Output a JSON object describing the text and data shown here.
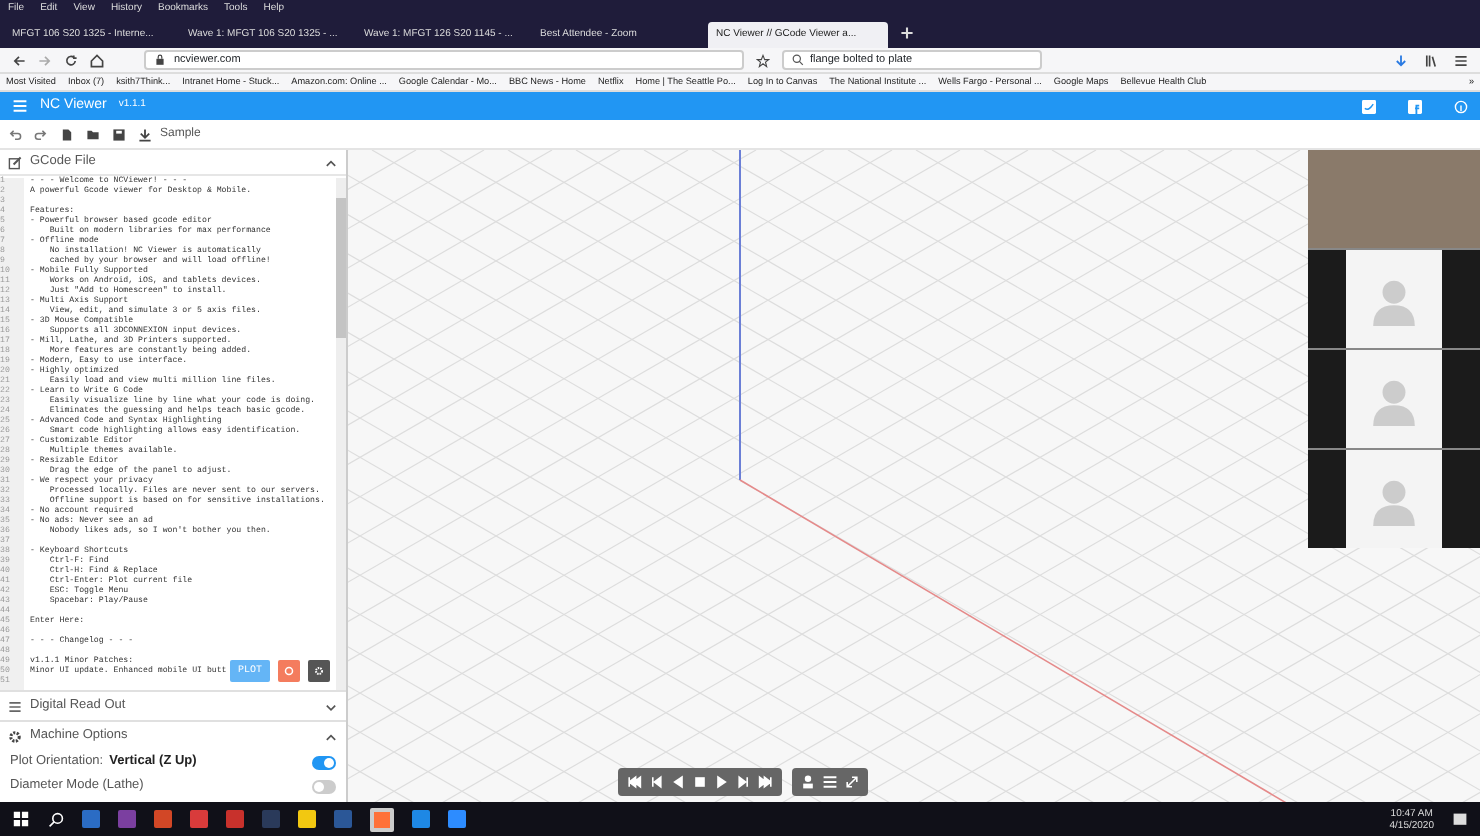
{
  "menu_bar": [
    "File",
    "Edit",
    "View",
    "History",
    "Bookmarks",
    "Tools",
    "Help"
  ],
  "tabs": [
    {
      "label": "MFGT 106 S20 1325 - Interne...",
      "selected": false
    },
    {
      "label": "Wave 1: MFGT 106 S20 1325 - ...",
      "selected": false
    },
    {
      "label": "Wave 1: MFGT 126 S20 1145 - ...",
      "selected": false
    },
    {
      "label": "Best Attendee - Zoom",
      "selected": false
    },
    {
      "label": "NC Viewer // GCode Viewer a...",
      "selected": true
    }
  ],
  "address_bar": {
    "url": "ncviewer.com",
    "search": "flange bolted to plate"
  },
  "bookmarks": [
    "Most Visited",
    "Inbox (7)",
    "ksith7Think...",
    "Intranet Home - Stuck...",
    "Amazon.com: Online ...",
    "Google Calendar - Mo...",
    "BBC News - Home",
    "Netflix",
    "Home | The Seattle Po...",
    "Log In to Canvas",
    "The National Institute ...",
    "Wells Fargo - Personal ...",
    "Google Maps",
    "Bellevue Health Club"
  ],
  "bookmarks_more": "»",
  "app_bar": {
    "title": "NC Viewer",
    "version": "v1.1.1"
  },
  "toolbar": {
    "sample": "Sample"
  },
  "gcode_panel": {
    "title": "GCode File",
    "lines": [
      {
        "n": "1",
        "text": "- - - Welcome to NCViewer! - - -"
      },
      {
        "n": "2",
        "text": "A powerful Gcode viewer for Desktop & Mobile."
      },
      {
        "n": "3"
      },
      {
        "n": "4",
        "text": "Features:"
      },
      {
        "n": "5",
        "text": "- Powerful browser based gcode editor"
      },
      {
        "n": "6",
        "text": "    Built on modern libraries for max performance"
      },
      {
        "n": "7",
        "text": "- Offline mode"
      },
      {
        "n": "8",
        "text": "    No installation! NC Viewer is automatically"
      },
      {
        "n": "9",
        "text": "    cached by your browser and will load offline!"
      },
      {
        "n": "10",
        "text": "- Mobile Fully Supported"
      },
      {
        "n": "11",
        "text": "    Works on Android, iOS, and tablets devices."
      },
      {
        "n": "12",
        "text": "    Just \"Add to Homescreen\" to install."
      },
      {
        "n": "13",
        "text": "- Multi Axis Support"
      },
      {
        "n": "14",
        "text": "    View, edit, and simulate 3 or 5 axis files."
      },
      {
        "n": "15",
        "text": "- 3D Mouse Compatible"
      },
      {
        "n": "16",
        "text": "    Supports all 3DCONNEXION input devices."
      },
      {
        "n": "17",
        "text": "- Mill, Lathe, and 3D Printers supported."
      },
      {
        "n": "18",
        "text": "    More features are constantly being added."
      },
      {
        "n": "19",
        "text": "- Modern, Easy to use interface."
      },
      {
        "n": "20",
        "text": "- Highly optimized"
      },
      {
        "n": "21",
        "text": "    Easily load and view multi million line files."
      },
      {
        "n": "22",
        "text": "- Learn to Write G Code"
      },
      {
        "n": "23",
        "text": "    Easily visualize line by line what your code is doing."
      },
      {
        "n": "24",
        "text": "    Eliminates the guessing and helps teach basic gcode."
      },
      {
        "n": "25",
        "text": "- Advanced Code and Syntax Highlighting"
      },
      {
        "n": "26",
        "text": "    Smart code highlighting allows easy identification."
      },
      {
        "n": "27",
        "text": "- Customizable Editor"
      },
      {
        "n": "28",
        "text": "    Multiple themes available."
      },
      {
        "n": "29",
        "text": "- Resizable Editor"
      },
      {
        "n": "30",
        "text": "    Drag the edge of the panel to adjust."
      },
      {
        "n": "31",
        "text": "- We respect your privacy"
      },
      {
        "n": "32",
        "text": "    Processed locally. Files are never sent to our servers."
      },
      {
        "n": "33",
        "text": "    Offline support is based on for sensitive installations."
      },
      {
        "n": "34",
        "text": "- No account required"
      },
      {
        "n": "35",
        "text": "- No ads: Never see an ad"
      },
      {
        "n": "36",
        "text": "    Nobody likes ads, so I won't bother you then."
      },
      {
        "n": "37"
      },
      {
        "n": "38",
        "text": "- Keyboard Shortcuts"
      },
      {
        "n": "39",
        "text": "    Ctrl-F: Find"
      },
      {
        "n": "40",
        "text": "    Ctrl-H: Find & Replace"
      },
      {
        "n": "41",
        "text": "    Ctrl-Enter: Plot current file"
      },
      {
        "n": "42",
        "text": "    ESC: Toggle Menu"
      },
      {
        "n": "43",
        "text": "    Spacebar: Play/Pause"
      },
      {
        "n": "44"
      },
      {
        "n": "45",
        "text": "Enter Here:"
      },
      {
        "n": "46"
      },
      {
        "n": "47",
        "text": "- - - Changelog - - -"
      },
      {
        "n": "48"
      },
      {
        "n": "49",
        "text": "v1.1.1 Minor Patches:"
      },
      {
        "n": "50",
        "text": "Minor UI update. Enhanced mobile UI butt"
      },
      {
        "n": "51"
      }
    ],
    "plot_button": "PLOT"
  },
  "sections": [
    {
      "title": "Digital Read Out",
      "expanded": false
    },
    {
      "title": "Machine Options",
      "expanded": true
    }
  ],
  "machine_options": [
    {
      "label": "Plot Orientation:",
      "value": "Vertical (Z Up)",
      "on": true
    },
    {
      "label": "Diameter Mode (Lathe)",
      "on": false
    }
  ],
  "video_tiles": [
    {
      "kind": "video"
    },
    {
      "kind": "avatar"
    },
    {
      "kind": "avatar"
    },
    {
      "kind": "avatar"
    }
  ],
  "taskbar": {
    "time": "10:47 AM",
    "date": "4/15/2020",
    "apps": [
      {
        "color": "#2b6cc4"
      },
      {
        "color": "#7b3fa0"
      },
      {
        "color": "#d24726"
      },
      {
        "color": "#d83b3b"
      },
      {
        "color": "#c8312c"
      },
      {
        "color": "#2a3a5a"
      },
      {
        "color": "#f2c811"
      },
      {
        "color": "#2b5797"
      },
      {
        "color": "#ff7139",
        "selected": true
      },
      {
        "color": "#1e88e5"
      },
      {
        "color": "#2d8cff"
      }
    ]
  }
}
